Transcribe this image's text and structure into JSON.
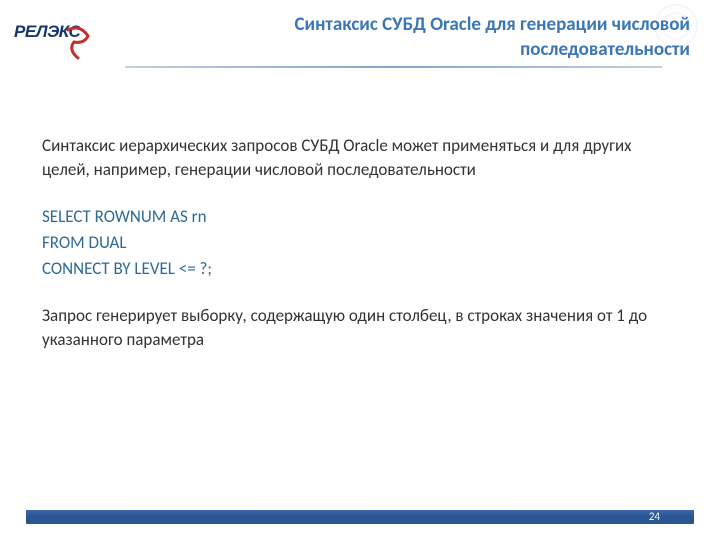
{
  "header": {
    "title_line1": "Синтаксис СУБД Oracle для генерации числовой",
    "title_line2": "последовательности",
    "logo_text": "РЕЛЭКС"
  },
  "body": {
    "para1": "Синтаксис иерархических запросов СУБД Oracle может применяться и для других целей, например, генерации числовой последовательности",
    "code_line1": "SELECT ROWNUM AS rn",
    "code_line2": "FROM DUAL",
    "code_line3": "CONNECT BY LEVEL <= ?;",
    "para2": "Запрос генерирует выборку, содержащую один столбец, в строках значения от 1 до указанного параметра"
  },
  "footer": {
    "page_number": "24"
  }
}
